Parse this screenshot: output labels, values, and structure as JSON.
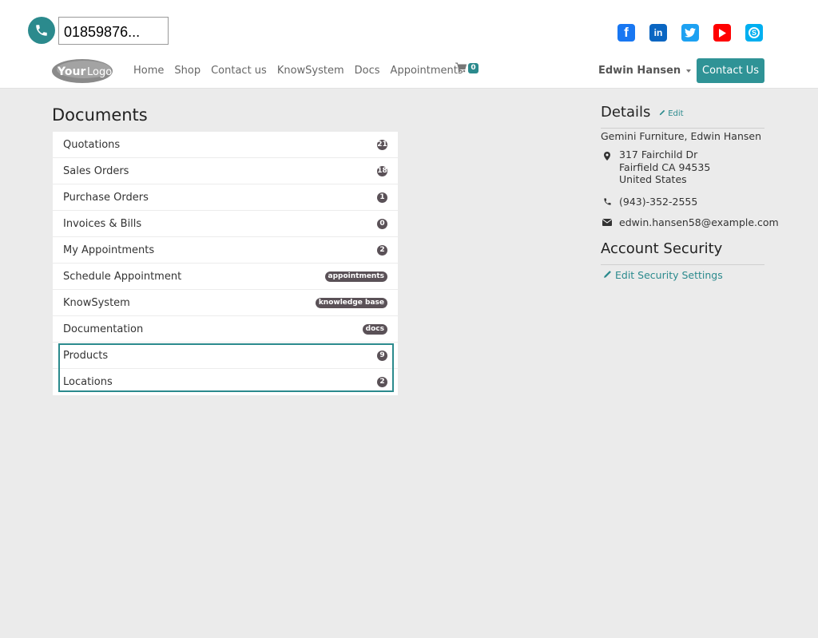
{
  "header": {
    "phone_number": "01859876...",
    "logo_text": "YourLogo",
    "nav_items": [
      "Home",
      "Shop",
      "Contact us",
      "KnowSystem",
      "Docs",
      "Appointments"
    ],
    "cart_count": "0",
    "user_name": "Edwin Hansen",
    "contact_button": "Contact Us",
    "social_icons": [
      "facebook-icon",
      "linkedin-icon",
      "twitter-icon",
      "youtube-icon",
      "skype-icon"
    ],
    "colors": {
      "accent": "#2b8a8d",
      "facebook": "#1877f2",
      "linkedin": "#0a66c2",
      "twitter": "#1da1f2",
      "youtube": "#ff0000",
      "skype": "#00aff0"
    }
  },
  "documents": {
    "title": "Documents",
    "rows": [
      {
        "label": "Quotations",
        "badge": "21"
      },
      {
        "label": "Sales Orders",
        "badge": "18"
      },
      {
        "label": "Purchase Orders",
        "badge": "1"
      },
      {
        "label": "Invoices & Bills",
        "badge": "0"
      },
      {
        "label": "My Appointments",
        "badge": "2"
      },
      {
        "label": "Schedule Appointment",
        "badge": "appointments"
      },
      {
        "label": "KnowSystem",
        "badge": "knowledge base"
      },
      {
        "label": "Documentation",
        "badge": "docs"
      },
      {
        "label": "Products",
        "badge": "9"
      },
      {
        "label": "Locations",
        "badge": "2"
      }
    ]
  },
  "details": {
    "title": "Details",
    "edit_label": "Edit",
    "company_line": "Gemini Furniture, Edwin Hansen",
    "address": [
      "317 Fairchild Dr",
      "Fairfield CA 94535",
      "United States"
    ],
    "phone": "(943)-352-2555",
    "email": "edwin.hansen58@example.com"
  },
  "security": {
    "title": "Account Security",
    "edit_label": "Edit Security Settings"
  }
}
